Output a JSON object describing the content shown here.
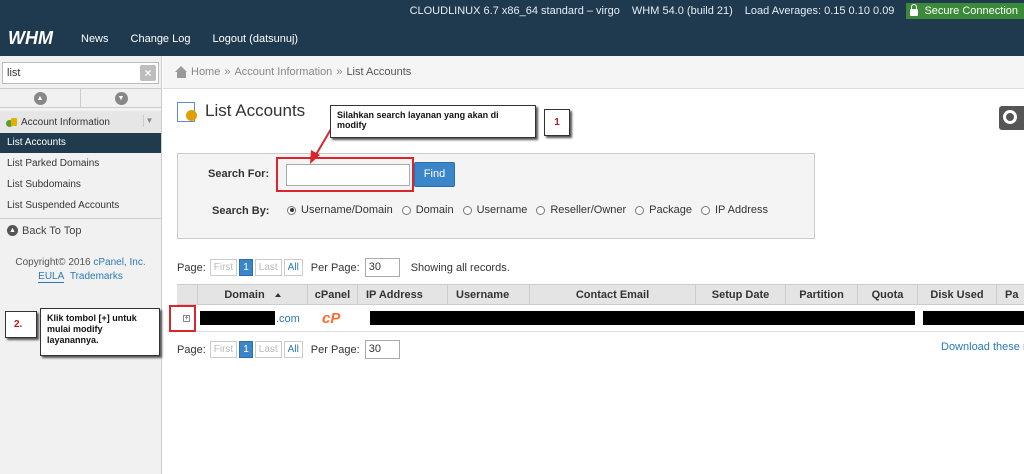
{
  "topbar": {
    "server_info": "CLOUDLINUX 6.7 x86_64 standard – virgo",
    "version": "WHM 54.0 (build 21)",
    "load_averages": "Load Averages: 0.15 0.10 0.09",
    "secure": "Secure Connection",
    "logo": "WHM",
    "nav": [
      "News",
      "Change Log",
      "Logout (datsunuj)"
    ]
  },
  "sidebar": {
    "search_value": "list",
    "clear_glyph": "×",
    "up_glyph": "▲",
    "down_glyph": "▼",
    "section_label": "Account Information",
    "section_chevron": "▼",
    "items": [
      "List Accounts",
      "List Parked Domains",
      "List Subdomains",
      "List Suspended Accounts"
    ],
    "active_index": 0,
    "back_to_top": "Back To Top",
    "copyright_prefix": "Copyright© 2016 ",
    "copyright_company": "cPanel, Inc.",
    "eula": "EULA",
    "trademarks": "Trademarks"
  },
  "breadcrumb": {
    "home": "Home",
    "sep": "»",
    "section": "Account Information",
    "current": "List Accounts"
  },
  "page": {
    "title": "List Accounts"
  },
  "search": {
    "search_for_label": "Search For:",
    "input_value": "",
    "find_label": "Find",
    "search_by_label": "Search By:",
    "options": [
      "Username/Domain",
      "Domain",
      "Username",
      "Reseller/Owner",
      "Package",
      "IP Address"
    ],
    "selected_index": 0
  },
  "pagination": {
    "page_label": "Page:",
    "first": "First",
    "current": "1",
    "last": "Last",
    "all": "All",
    "per_page_label": "Per Page:",
    "per_page_value": "30",
    "showing": "Showing all records."
  },
  "table": {
    "columns": [
      "Domain",
      "cPanel",
      "IP Address",
      "Username",
      "Contact Email",
      "Setup Date",
      "Partition",
      "Quota",
      "Disk Used",
      "Pa"
    ],
    "row": {
      "expand_glyph": "+",
      "domain_suffix": ".com",
      "cpanel_logo": "cP"
    }
  },
  "download_link": "Download these r",
  "annotations": {
    "note1": "Silahkan search layanan yang akan di modify",
    "num1": "1",
    "note2": "Klik tombol [+] untuk mulai modify layanannya.",
    "num2": "2."
  },
  "colors": {
    "topbar_bg": "#1f3a4f",
    "active_item_bg": "#203a4e",
    "accent_blue": "#3a86c8",
    "secure_green": "#3a8a3a",
    "annotation_red": "#d9262c",
    "cpanel_orange": "#ff6c2c"
  }
}
